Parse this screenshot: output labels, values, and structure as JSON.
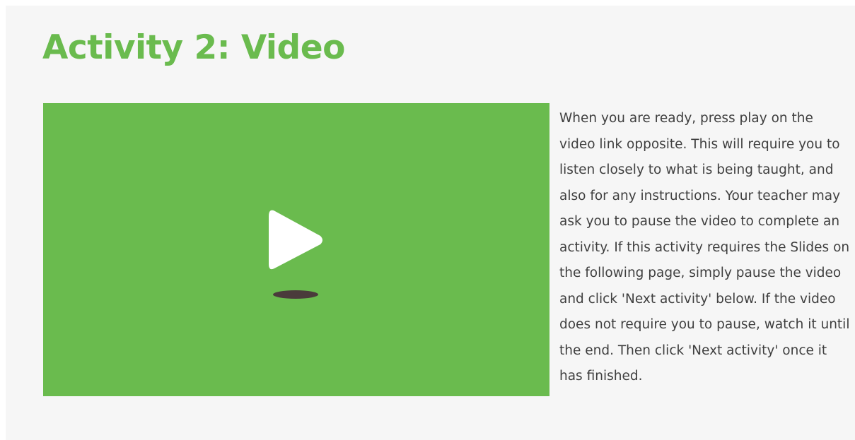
{
  "activity": {
    "title": "Activity 2: Video",
    "title_color": "#6abb4e",
    "description": "When you are ready, press play on the video link opposite. This will require you to listen closely to what is being taught, and also for any instructions. Your teacher may ask you to pause the video to complete an activity. If this activity requires the Slides on the following page, simply pause the video and click 'Next activity' below. If the video does not require you to pause, watch it until the end. Then click 'Next activity' once it has finished."
  },
  "video": {
    "background_color": "#6abb4e",
    "icon": "play-icon",
    "icon_color": "#ffffff",
    "shadow_color": "#4a3b3b"
  },
  "page": {
    "background_color": "#f6f6f6"
  }
}
